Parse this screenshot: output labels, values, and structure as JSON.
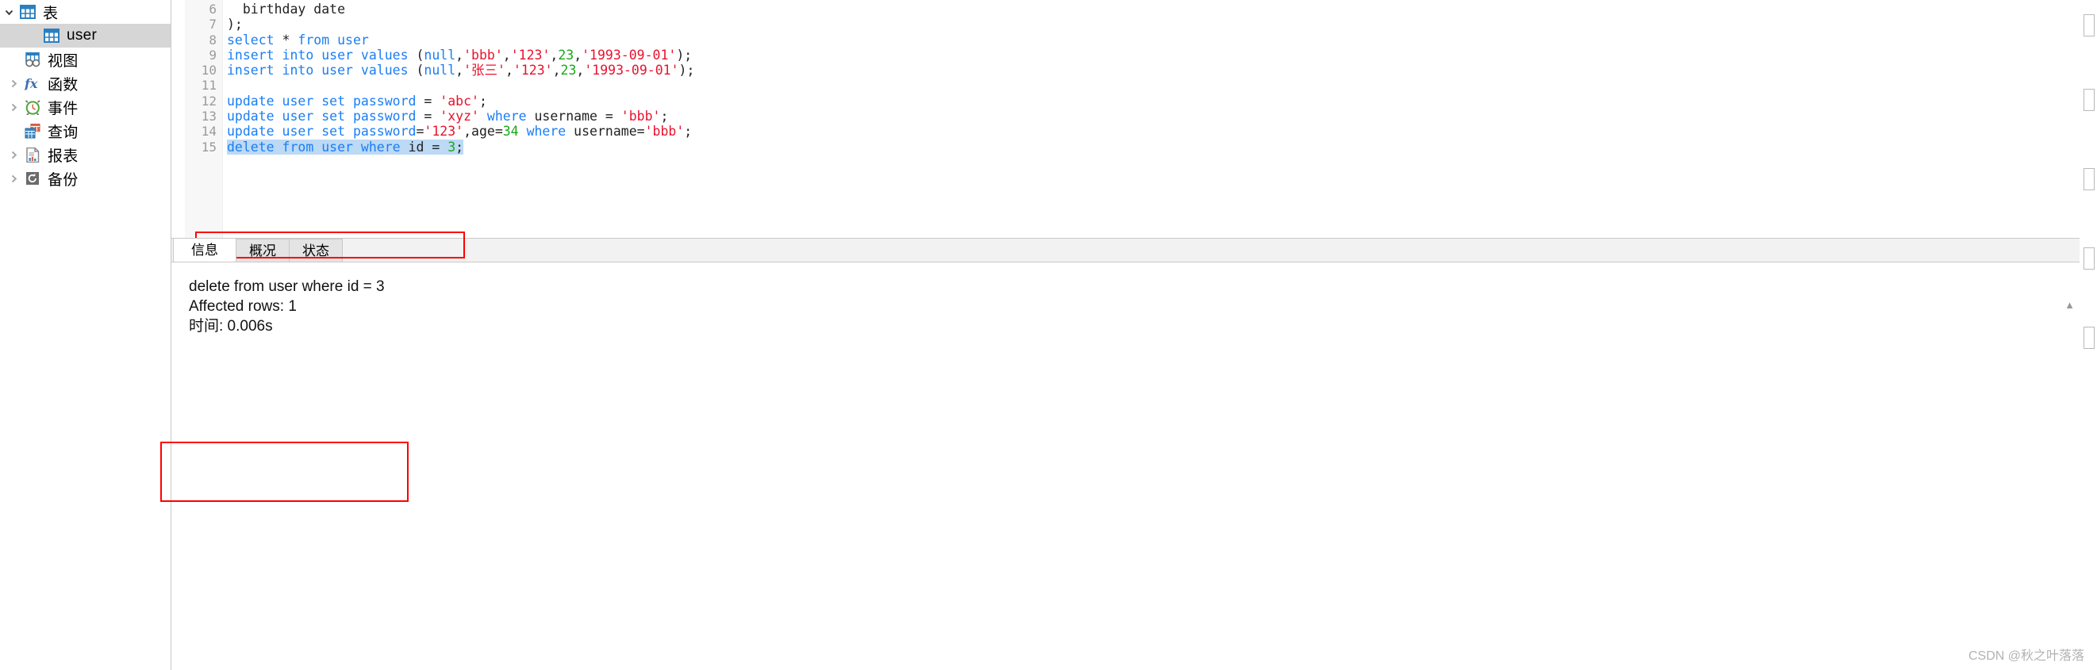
{
  "sidebar": {
    "items": [
      {
        "label": "表",
        "icon": "table-grid-icon",
        "twisty": "down",
        "selected": false,
        "indent": 22
      },
      {
        "label": "user",
        "icon": "table-grid-icon",
        "twisty": "none",
        "selected": true,
        "indent": 52
      },
      {
        "label": "视图",
        "icon": "view-glasses-icon",
        "twisty": "none",
        "selected": false,
        "indent": 28
      },
      {
        "label": "函数",
        "icon": "function-fx-icon",
        "twisty": "right",
        "selected": false,
        "indent": 28
      },
      {
        "label": "事件",
        "icon": "event-clock-icon",
        "twisty": "right",
        "selected": false,
        "indent": 28
      },
      {
        "label": "查询",
        "icon": "query-icon",
        "twisty": "none",
        "selected": false,
        "indent": 28
      },
      {
        "label": "报表",
        "icon": "report-doc-icon",
        "twisty": "right",
        "selected": false,
        "indent": 28
      },
      {
        "label": "备份",
        "icon": "backup-restore-icon",
        "twisty": "right",
        "selected": false,
        "indent": 28
      }
    ]
  },
  "editor": {
    "line_numbers": [
      "6",
      "7",
      "8",
      "9",
      "10",
      "11",
      "12",
      "13",
      "14",
      "15"
    ],
    "lines": [
      {
        "n": "6",
        "tokens": [
          {
            "t": "  ",
            "c": "pln"
          },
          {
            "t": "birthday date",
            "c": "pln"
          }
        ]
      },
      {
        "n": "7",
        "tokens": [
          {
            "t": ");",
            "c": "punc"
          }
        ]
      },
      {
        "n": "8",
        "tokens": [
          {
            "t": "select",
            "c": "kw"
          },
          {
            "t": " ",
            "c": "pln"
          },
          {
            "t": "*",
            "c": "pln"
          },
          {
            "t": " ",
            "c": "pln"
          },
          {
            "t": "from",
            "c": "kw"
          },
          {
            "t": " ",
            "c": "pln"
          },
          {
            "t": "user",
            "c": "kw"
          }
        ]
      },
      {
        "n": "9",
        "tokens": [
          {
            "t": "insert",
            "c": "kw"
          },
          {
            "t": " ",
            "c": "pln"
          },
          {
            "t": "into",
            "c": "kw"
          },
          {
            "t": " ",
            "c": "pln"
          },
          {
            "t": "user",
            "c": "kw"
          },
          {
            "t": " ",
            "c": "pln"
          },
          {
            "t": "values",
            "c": "kw"
          },
          {
            "t": " (",
            "c": "punc"
          },
          {
            "t": "null",
            "c": "kw"
          },
          {
            "t": ",",
            "c": "punc"
          },
          {
            "t": "'bbb'",
            "c": "str"
          },
          {
            "t": ",",
            "c": "punc"
          },
          {
            "t": "'123'",
            "c": "str"
          },
          {
            "t": ",",
            "c": "punc"
          },
          {
            "t": "23",
            "c": "num"
          },
          {
            "t": ",",
            "c": "punc"
          },
          {
            "t": "'1993-09-01'",
            "c": "str"
          },
          {
            "t": ");",
            "c": "punc"
          }
        ]
      },
      {
        "n": "10",
        "tokens": [
          {
            "t": "insert",
            "c": "kw"
          },
          {
            "t": " ",
            "c": "pln"
          },
          {
            "t": "into",
            "c": "kw"
          },
          {
            "t": " ",
            "c": "pln"
          },
          {
            "t": "user",
            "c": "kw"
          },
          {
            "t": " ",
            "c": "pln"
          },
          {
            "t": "values",
            "c": "kw"
          },
          {
            "t": " (",
            "c": "punc"
          },
          {
            "t": "null",
            "c": "kw"
          },
          {
            "t": ",",
            "c": "punc"
          },
          {
            "t": "'张三'",
            "c": "str"
          },
          {
            "t": ",",
            "c": "punc"
          },
          {
            "t": "'123'",
            "c": "str"
          },
          {
            "t": ",",
            "c": "punc"
          },
          {
            "t": "23",
            "c": "num"
          },
          {
            "t": ",",
            "c": "punc"
          },
          {
            "t": "'1993-09-01'",
            "c": "str"
          },
          {
            "t": ");",
            "c": "punc"
          }
        ]
      },
      {
        "n": "11",
        "tokens": []
      },
      {
        "n": "12",
        "tokens": [
          {
            "t": "update",
            "c": "kw"
          },
          {
            "t": " ",
            "c": "pln"
          },
          {
            "t": "user",
            "c": "kw"
          },
          {
            "t": " ",
            "c": "pln"
          },
          {
            "t": "set",
            "c": "kw"
          },
          {
            "t": " ",
            "c": "pln"
          },
          {
            "t": "password",
            "c": "kw"
          },
          {
            "t": " = ",
            "c": "punc"
          },
          {
            "t": "'abc'",
            "c": "str"
          },
          {
            "t": ";",
            "c": "punc"
          }
        ]
      },
      {
        "n": "13",
        "tokens": [
          {
            "t": "update",
            "c": "kw"
          },
          {
            "t": " ",
            "c": "pln"
          },
          {
            "t": "user",
            "c": "kw"
          },
          {
            "t": " ",
            "c": "pln"
          },
          {
            "t": "set",
            "c": "kw"
          },
          {
            "t": " ",
            "c": "pln"
          },
          {
            "t": "password",
            "c": "kw"
          },
          {
            "t": " = ",
            "c": "punc"
          },
          {
            "t": "'xyz'",
            "c": "str"
          },
          {
            "t": " ",
            "c": "pln"
          },
          {
            "t": "where",
            "c": "kw"
          },
          {
            "t": " username = ",
            "c": "punc"
          },
          {
            "t": "'bbb'",
            "c": "str"
          },
          {
            "t": ";",
            "c": "punc"
          }
        ]
      },
      {
        "n": "14",
        "tokens": [
          {
            "t": "update",
            "c": "kw"
          },
          {
            "t": " ",
            "c": "pln"
          },
          {
            "t": "user",
            "c": "kw"
          },
          {
            "t": " ",
            "c": "pln"
          },
          {
            "t": "set",
            "c": "kw"
          },
          {
            "t": " ",
            "c": "pln"
          },
          {
            "t": "password",
            "c": "kw"
          },
          {
            "t": "=",
            "c": "punc"
          },
          {
            "t": "'123'",
            "c": "str"
          },
          {
            "t": ",age=",
            "c": "punc"
          },
          {
            "t": "34",
            "c": "num"
          },
          {
            "t": " ",
            "c": "pln"
          },
          {
            "t": "where",
            "c": "kw"
          },
          {
            "t": " username=",
            "c": "punc"
          },
          {
            "t": "'bbb'",
            "c": "str"
          },
          {
            "t": ";",
            "c": "punc"
          }
        ]
      },
      {
        "n": "15",
        "selected": true,
        "tokens": [
          {
            "t": "delete",
            "c": "kw"
          },
          {
            "t": " ",
            "c": "pln"
          },
          {
            "t": "from",
            "c": "kw"
          },
          {
            "t": " ",
            "c": "pln"
          },
          {
            "t": "user",
            "c": "kw"
          },
          {
            "t": " ",
            "c": "pln"
          },
          {
            "t": "where",
            "c": "kw"
          },
          {
            "t": " id = ",
            "c": "punc"
          },
          {
            "t": "3",
            "c": "num"
          },
          {
            "t": ";",
            "c": "punc"
          }
        ]
      }
    ]
  },
  "results": {
    "tabs": [
      {
        "label": "信息",
        "active": true
      },
      {
        "label": "概况",
        "active": false
      },
      {
        "label": "状态",
        "active": false
      }
    ],
    "message_lines": [
      "delete from user where id = 3",
      "Affected rows: 1",
      "时间: 0.006s"
    ]
  },
  "watermark": {
    "text": "CSDN @秋之叶落落"
  },
  "colors": {
    "keyword": "#1a7ef5",
    "string": "#e8122e",
    "number": "#18a818",
    "selection": "#bcd9f5",
    "annotation": "#ff0000",
    "sidebar_selected": "#d6d6d6"
  }
}
